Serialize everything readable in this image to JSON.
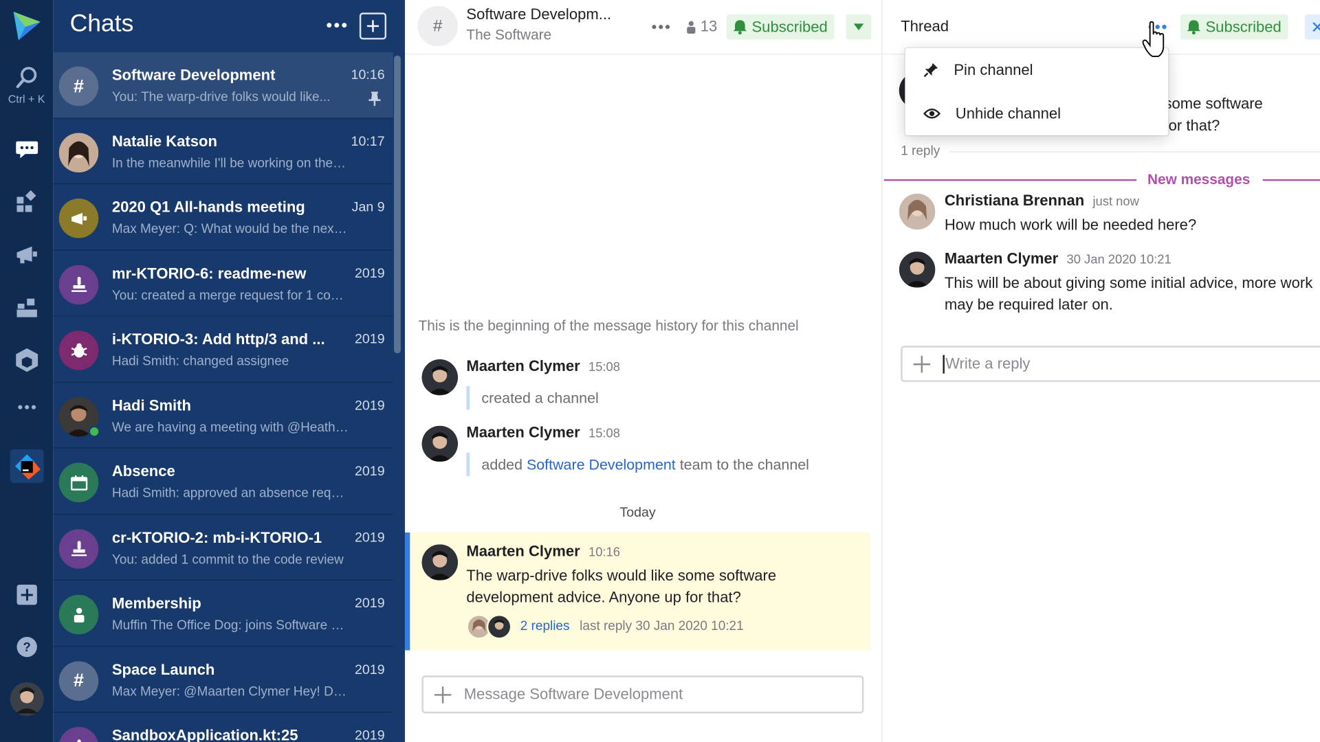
{
  "rail": {
    "search_caption": "Ctrl + K",
    "icons": [
      "space-logo",
      "search-icon",
      "chat-icon",
      "dashboard-icon",
      "megaphone-icon",
      "team-icon",
      "package-icon",
      "more-icon",
      "jetbrains-icon",
      "add-icon",
      "help-icon",
      "user-avatar"
    ]
  },
  "sidebar": {
    "title": "Chats",
    "chats": [
      {
        "name": "Software Development",
        "time": "10:16",
        "preview": "You: The warp-drive folks would like...",
        "avatar": "#",
        "color": "#5a6f8f",
        "pinned": true
      },
      {
        "name": "Natalie Katson",
        "time": "10:17",
        "preview": "In the meanwhile I'll be working on the n...",
        "avatar": "photo",
        "color": "#caa58e"
      },
      {
        "name": "2020 Q1 All-hands meeting",
        "time": "Jan 9",
        "preview": "Max Meyer: Q: What would be the next ...",
        "avatar": "megaphone",
        "color": "#8b7a2a"
      },
      {
        "name": "mr-KTORIO-6: readme-new",
        "time": "2019",
        "preview": "You: created a merge request for 1 com...",
        "avatar": "stamp",
        "color": "#6b3f8f"
      },
      {
        "name": "i-KTORIO-3: Add http/3 and ...",
        "time": "2019",
        "preview": "Hadi Smith: changed assignee",
        "avatar": "bug",
        "color": "#7d2a6f"
      },
      {
        "name": "Hadi Smith",
        "time": "2019",
        "preview": "We are having a meeting with @Heather...",
        "avatar": "photo",
        "color": "#6b4a3a",
        "online": true
      },
      {
        "name": "Absence",
        "time": "2019",
        "preview": "Hadi Smith: approved an absence request",
        "avatar": "calendar",
        "color": "#2a7a5a"
      },
      {
        "name": "cr-KTORIO-2: mb-i-KTORIO-1",
        "time": "2019",
        "preview": "You: added 1 commit to the code review",
        "avatar": "stamp",
        "color": "#6b3f8f"
      },
      {
        "name": "Membership",
        "time": "2019",
        "preview": "Muffin The Office Dog: joins Software D...",
        "avatar": "person",
        "color": "#2a7a5a"
      },
      {
        "name": "Space Launch",
        "time": "2019",
        "preview": "Max Meyer: @Maarten Clymer Hey! Do y...",
        "avatar": "#",
        "color": "#5a6f8f"
      },
      {
        "name": "SandboxApplication.kt:25",
        "time": "2019",
        "preview": "",
        "avatar": "stamp",
        "color": "#6b3f8f"
      }
    ]
  },
  "channel": {
    "title": "Software Developm...",
    "subtitle": "The Software",
    "member_count": "13",
    "subscribed_label": "Subscribed",
    "history_note": "This is the beginning of the message history for this channel",
    "messages": [
      {
        "author": "Maarten Clymer",
        "time": "15:08",
        "text": "created a channel"
      },
      {
        "author": "Maarten Clymer",
        "time": "15:08",
        "text_before": "added ",
        "link": "Software Development",
        "text_after": " team to the channel"
      }
    ],
    "today_label": "Today",
    "highlight": {
      "author": "Maarten Clymer",
      "time": "10:16",
      "text": "The warp-drive folks would like some software development advice. Anyone up for that?",
      "replies_label": "2 replies",
      "last_reply": "last reply 30 Jan 2020 10:21"
    },
    "composer_placeholder": "Message Software Development"
  },
  "thread": {
    "title": "Thread",
    "subscribed_label": "Subscribed",
    "partial_line1": "e some software",
    "partial_line2": "p for that?",
    "reply_count": "1 reply",
    "new_messages_label": "New messages",
    "replies": [
      {
        "author": "Christiana Brennan",
        "time": "just now",
        "text": "How much work will be needed here?"
      },
      {
        "author": "Maarten Clymer",
        "time": "30 Jan 2020 10:21",
        "text": "This will be about giving some initial advice, more work may be required later on."
      }
    ],
    "reply_placeholder": "Write a reply"
  },
  "menu": {
    "items": [
      {
        "label": "Pin channel",
        "icon": "pin-icon"
      },
      {
        "label": "Unhide channel",
        "icon": "eye-icon"
      }
    ]
  },
  "colors": {
    "rail_bg": "#0f2b52",
    "sidebar_bg": "#17396b",
    "accent": "#2f7fe6",
    "subscribed_green": "#2f8f3c",
    "new_messages": "#b251a8",
    "highlight_bg": "#fefcdc"
  }
}
